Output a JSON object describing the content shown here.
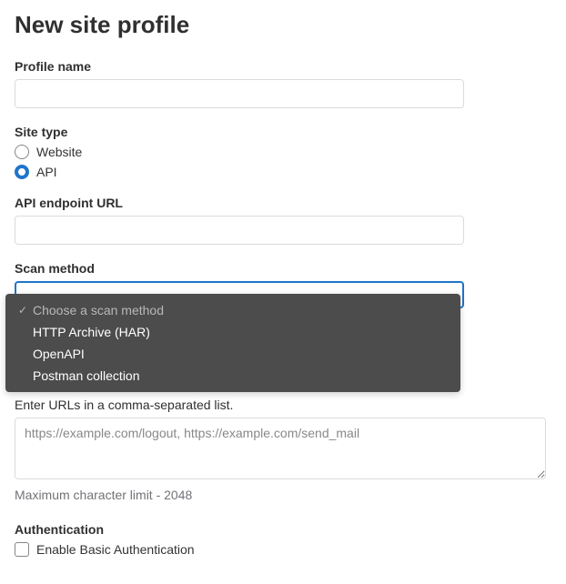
{
  "page_title": "New site profile",
  "profile_name": {
    "label": "Profile name",
    "value": ""
  },
  "site_type": {
    "label": "Site type",
    "options": [
      {
        "label": "Website",
        "selected": false
      },
      {
        "label": "API",
        "selected": true
      }
    ]
  },
  "api_endpoint": {
    "label": "API endpoint URL",
    "value": ""
  },
  "scan_method": {
    "label": "Scan method",
    "placeholder": "Choose a scan method",
    "options": [
      "HTTP Archive (HAR)",
      "OpenAPI",
      "Postman collection"
    ]
  },
  "excluded_urls": {
    "helper": "Enter URLs in a comma-separated list.",
    "placeholder": "https://example.com/logout, https://example.com/send_mail",
    "value": "",
    "limit": "Maximum character limit - 2048"
  },
  "authentication": {
    "label": "Authentication",
    "checkbox_label": "Enable Basic Authentication",
    "checked": false
  }
}
